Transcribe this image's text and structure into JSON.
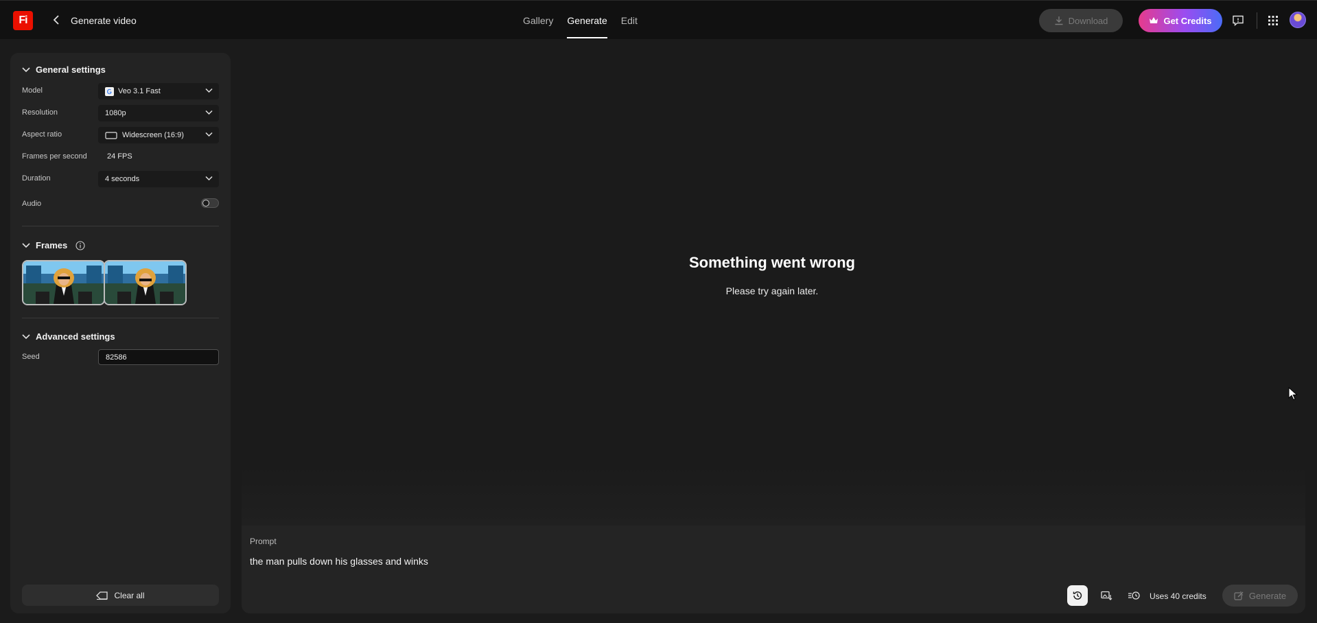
{
  "header": {
    "logo_text": "Fi",
    "title": "Generate video",
    "tabs": [
      {
        "label": "Gallery",
        "active": false
      },
      {
        "label": "Generate",
        "active": true
      },
      {
        "label": "Edit",
        "active": false
      }
    ],
    "download_label": "Download",
    "get_credits_label": "Get Credits",
    "brand_color": "#eb1000"
  },
  "sidebar": {
    "general": {
      "title": "General settings",
      "model": {
        "label": "Model",
        "value": "Veo 3.1 Fast"
      },
      "resolution": {
        "label": "Resolution",
        "value": "1080p"
      },
      "aspect": {
        "label": "Aspect ratio",
        "value": "Widescreen (16:9)"
      },
      "fps": {
        "label": "Frames per second",
        "value": "24 FPS"
      },
      "duration": {
        "label": "Duration",
        "value": "4 seconds"
      },
      "audio": {
        "label": "Audio",
        "enabled": false
      }
    },
    "frames": {
      "title": "Frames",
      "count": 2
    },
    "advanced": {
      "title": "Advanced settings",
      "seed": {
        "label": "Seed",
        "value": "82586"
      }
    },
    "clear_all_label": "Clear all"
  },
  "main": {
    "error_title": "Something went wrong",
    "error_subtitle": "Please try again later."
  },
  "prompt": {
    "label": "Prompt",
    "text": "the man pulls down his glasses and winks",
    "uses_credits": "Uses 40 credits",
    "generate_label": "Generate"
  }
}
